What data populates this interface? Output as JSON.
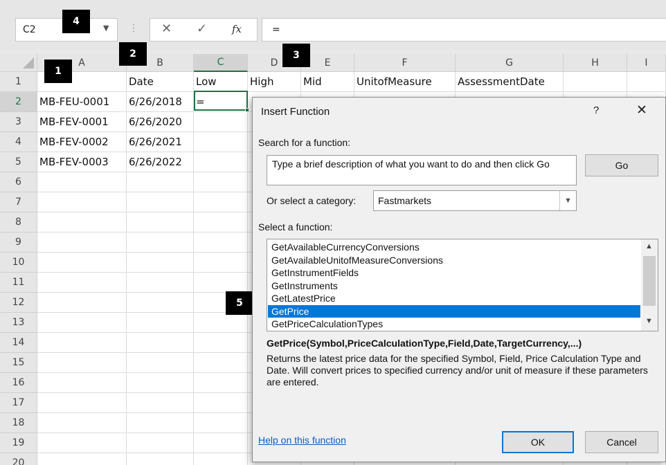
{
  "formula_bar": {
    "name_box": "C2",
    "cancel_symbol": "✕",
    "enter_symbol": "✓",
    "fx_symbol": "fx",
    "formula": "="
  },
  "sheet": {
    "column_headers": [
      "A",
      "B",
      "C",
      "D",
      "E",
      "F",
      "G",
      "H",
      "I"
    ],
    "row_numbers": [
      "1",
      "2",
      "3",
      "4",
      "5",
      "6",
      "7",
      "8",
      "9",
      "10",
      "11",
      "12",
      "13",
      "14",
      "15",
      "16",
      "17",
      "18",
      "19",
      "20"
    ],
    "selected_column": "C",
    "selected_row": "2",
    "rows": [
      [
        "",
        "Date",
        "Low",
        "High",
        "Mid",
        "UnitofMeasure",
        "AssessmentDate",
        "",
        ""
      ],
      [
        "MB-FEU-0001",
        "6/26/2018",
        "=",
        "",
        "",
        "",
        "",
        "",
        ""
      ],
      [
        "MB-FEV-0001",
        "6/26/2020",
        "",
        "",
        "",
        "",
        "",
        "",
        ""
      ],
      [
        "MB-FEV-0002",
        "6/26/2021",
        "",
        "",
        "",
        "",
        "",
        "",
        ""
      ],
      [
        "MB-FEV-0003",
        "6/26/2022",
        "",
        "",
        "",
        "",
        "",
        "",
        ""
      ]
    ]
  },
  "callouts": [
    "1",
    "2",
    "3",
    "4",
    "5"
  ],
  "dialog": {
    "title": "Insert Function",
    "help": "?",
    "close": "✕",
    "search_label": "Search for a function:",
    "search_text": "Type a brief description of what you want to do and then click Go",
    "go_label": "Go",
    "category_label": "Or select a category:",
    "category_value": "Fastmarkets",
    "function_label": "Select a function:",
    "functions": [
      "GetAvailableCurrencyConversions",
      "GetAvailableUnitofMeasureConversions",
      "GetInstrumentFields",
      "GetInstruments",
      "GetLatestPrice",
      "GetPrice",
      "GetPriceCalculationTypes"
    ],
    "selected_function": "GetPrice",
    "signature": "GetPrice(Symbol,PriceCalculationType,Field,Date,TargetCurrency,...)",
    "description": "Returns the latest price data for the specified Symbol, Field, Price Calculation Type and Date. Will convert prices to specified currency and/or unit of measure if these parameters are entered.",
    "help_link": "Help on this function",
    "ok_label": "OK",
    "cancel_label": "Cancel"
  }
}
